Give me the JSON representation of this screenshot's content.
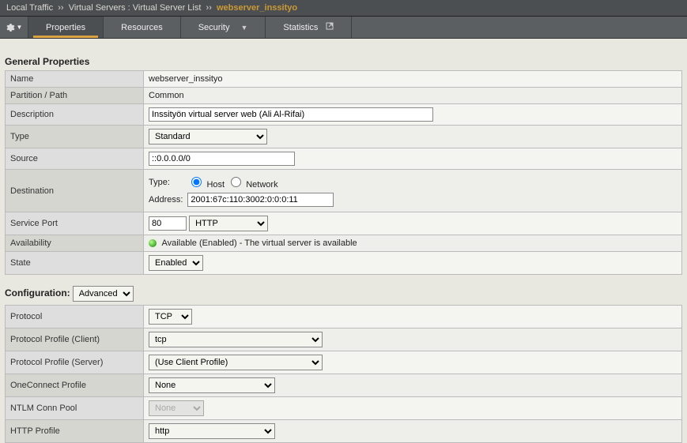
{
  "breadcrumb": {
    "part1": "Local Traffic",
    "sep": "››",
    "part2": "Virtual Servers : Virtual Server List",
    "current": "webserver_inssityo"
  },
  "tabs": {
    "properties": "Properties",
    "resources": "Resources",
    "security": "Security",
    "statistics": "Statistics"
  },
  "section_general": "General Properties",
  "general": {
    "name_label": "Name",
    "name_value": "webserver_inssityo",
    "partition_label": "Partition / Path",
    "partition_value": "Common",
    "description_label": "Description",
    "description_value": "Inssityön virtual server web (Ali Al-Rifai)",
    "type_label": "Type",
    "type_value": "Standard",
    "source_label": "Source",
    "source_value": "::0.0.0.0/0",
    "destination_label": "Destination",
    "dest_type_label": "Type:",
    "dest_radio_host": "Host",
    "dest_radio_network": "Network",
    "dest_address_label": "Address:",
    "dest_address_value": "2001:67c:110:3002:0:0:0:11",
    "port_label": "Service Port",
    "port_value": "80",
    "port_service": "HTTP",
    "availability_label": "Availability",
    "availability_text": "Available (Enabled) - The virtual server is available",
    "state_label": "State",
    "state_value": "Enabled"
  },
  "config_label": "Configuration:",
  "config_level": "Advanced",
  "config": {
    "protocol_label": "Protocol",
    "protocol_value": "TCP",
    "profile_client_label": "Protocol Profile (Client)",
    "profile_client_value": "tcp",
    "profile_server_label": "Protocol Profile (Server)",
    "profile_server_value": "(Use Client Profile)",
    "oneconnect_label": "OneConnect Profile",
    "oneconnect_value": "None",
    "ntlm_label": "NTLM Conn Pool",
    "ntlm_value": "None",
    "http_label": "HTTP Profile",
    "http_value": "http"
  }
}
